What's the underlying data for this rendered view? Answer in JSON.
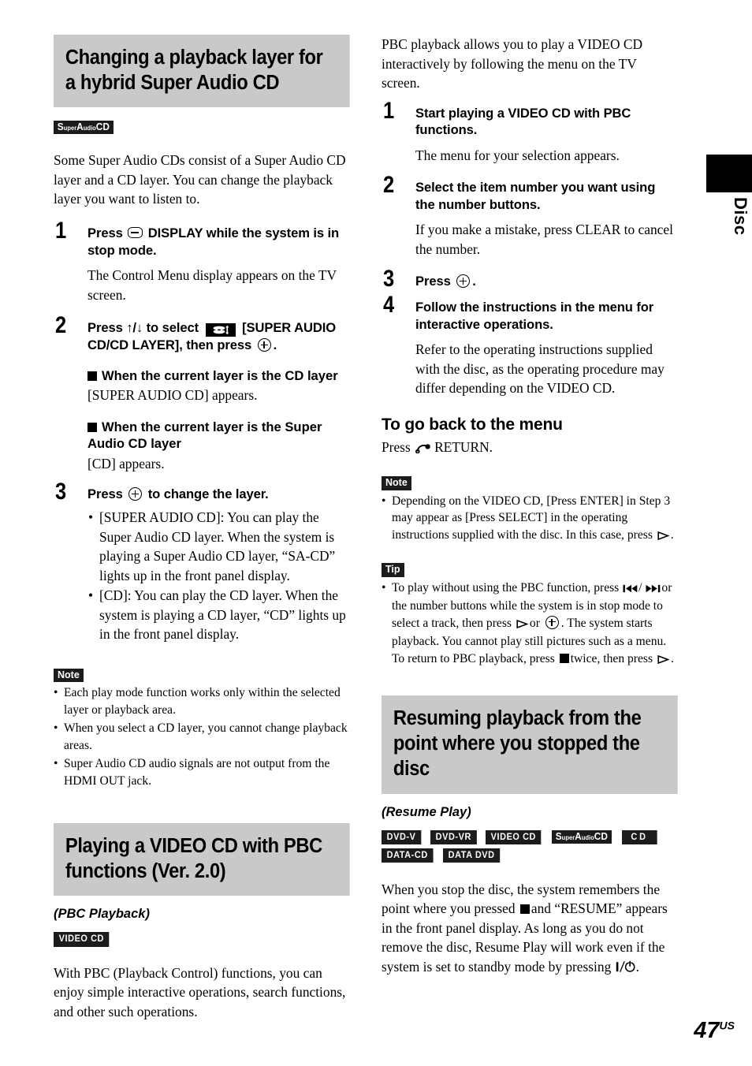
{
  "page": {
    "number": "47",
    "region_suffix": "US",
    "side_tab_label": "Disc"
  },
  "left_column": {
    "section1": {
      "heading_line1": "Changing a playback layer for",
      "heading_line2": "a hybrid Super Audio CD",
      "badges": [
        {
          "type": "super-audio-cd",
          "label": "SuperAudioCD"
        }
      ],
      "intro": "Some Super Audio CDs consist of a Super Audio CD layer and a CD layer. You can change the playback layer you want to listen to.",
      "steps": [
        {
          "num": "1",
          "head_before_icon": "Press",
          "icon": "display-button-icon",
          "head_after_icon": "DISPLAY while the system is in stop mode.",
          "detail": "The Control Menu display appears on the TV screen."
        },
        {
          "num": "2",
          "head_part1": "Press ↑/↓ to select",
          "icon": "super-audio-cd-cd-layer-icon",
          "head_part2": "[SUPER AUDIO CD/CD LAYER], then press",
          "icon2": "enter-button-icon",
          "head_part3": ".",
          "sub_sections": [
            {
              "head": "When the current layer is the CD layer",
              "body": "[SUPER AUDIO CD] appears."
            },
            {
              "head": "When the current layer is the Super Audio CD layer",
              "body": "[CD] appears."
            }
          ]
        },
        {
          "num": "3",
          "head_before_icon": "Press",
          "icon": "enter-button-icon",
          "head_after_icon": "to change the layer.",
          "bullets": [
            "[SUPER AUDIO CD]: You can play the Super Audio CD layer. When the system is playing a Super Audio CD layer, “SA-CD” lights up in the front panel display.",
            "[CD]: You can play the CD layer. When the system is playing a CD layer, “CD” lights up in the front panel display."
          ]
        }
      ],
      "note": {
        "tag": "Note",
        "items": [
          "Each play mode function works only within the selected layer or playback area.",
          "When you select a CD layer, you cannot change playback areas.",
          "Super Audio CD audio signals are not output from the HDMI OUT jack."
        ]
      }
    },
    "section2": {
      "heading_line1": "Playing a VIDEO CD with PBC",
      "heading_line2": "functions (Ver. 2.0)",
      "subtitle": "(PBC Playback)",
      "badges": [
        {
          "type": "video-cd",
          "label": "VIDEO CD"
        }
      ],
      "intro": "With PBC (Playback Control) functions, you can enjoy simple interactive operations, search functions, and other such operations."
    }
  },
  "right_column": {
    "intro": "PBC playback allows you to play a VIDEO CD interactively by following the menu on the TV screen.",
    "steps": [
      {
        "num": "1",
        "head": "Start playing a VIDEO CD with PBC functions.",
        "detail": "The menu for your selection appears."
      },
      {
        "num": "2",
        "head": "Select the item number you want using the number buttons.",
        "detail": "If you make a mistake, press CLEAR to cancel the number."
      },
      {
        "num": "3",
        "head_before_icon": "Press",
        "icon": "enter-button-icon",
        "head_after_icon": "."
      },
      {
        "num": "4",
        "head": "Follow the instructions in the menu for interactive operations.",
        "detail": "Refer to the operating instructions supplied with the disc, as the operating procedure may differ depending on the VIDEO CD."
      }
    ],
    "subheading": "To go back to the menu",
    "subheading_body_before_icon": "Press",
    "subheading_icon": "return-button-icon",
    "subheading_body_after_icon": "RETURN.",
    "note": {
      "tag": "Note",
      "item_part1": "Depending on the VIDEO CD, [Press ENTER] in Step 3 may appear as [Press SELECT] in the operating instructions supplied with the disc. In this case, press",
      "item_icon": "play-button-icon",
      "item_part2": "."
    },
    "tip": {
      "tag": "Tip",
      "part1": "To play without using the PBC function, press",
      "icon1": "previous-track-icon",
      "sep": "/",
      "icon2": "next-track-icon",
      "part2": "or the number buttons while the system is in stop mode to select a track, then press",
      "icon3": "play-button-icon",
      "part3": "or",
      "icon4": "enter-button-icon",
      "part4": ". The system starts playback. You cannot play still pictures such as a menu. To return to PBC playback, press",
      "icon5": "stop-button-icon",
      "part5": "twice, then press",
      "icon6": "play-button-icon",
      "part6": "."
    },
    "section3": {
      "heading_line1": "Resuming playback from the",
      "heading_line2": "point where you stopped the",
      "heading_line3": "disc",
      "subtitle": "(Resume Play)",
      "badges": [
        {
          "type": "dvd-v",
          "label": "DVD-V"
        },
        {
          "type": "dvd-vr",
          "label": "DVD-VR"
        },
        {
          "type": "video-cd",
          "label": "VIDEO CD"
        },
        {
          "type": "super-audio-cd",
          "label": "SuperAudioCD"
        },
        {
          "type": "cd",
          "label": "CD"
        },
        {
          "type": "data-cd",
          "label": "DATA-CD"
        },
        {
          "type": "data-dvd",
          "label": "DATA DVD"
        }
      ],
      "body_part1": "When you stop the disc, the system remembers the point where you pressed",
      "body_icon1": "stop-button-icon",
      "body_part2": "and “RESUME” appears in the front panel display. As long as you do not remove the disc, Resume Play will work even if the system is set to standby mode by pressing",
      "body_icon2": "power-standby-icon",
      "body_part3": "."
    }
  },
  "colors": {
    "heading_background": "#c9c9c9",
    "badge_background": "#1c1c1c",
    "text": "#000000",
    "page_background": "#ffffff"
  }
}
